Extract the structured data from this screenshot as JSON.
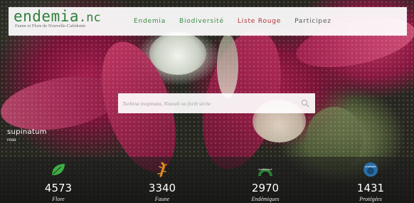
{
  "header": {
    "logo": {
      "main": "endemia",
      "suffix": ".nc",
      "subtitle": "Faune et Flore de Nouvelle-Calédonie"
    },
    "nav": [
      {
        "label": "Endemia"
      },
      {
        "label": "Biodiversité"
      },
      {
        "label": "Liste Rouge"
      },
      {
        "label": "Participez"
      }
    ]
  },
  "search": {
    "placeholder": "Turbina inopinata, Niaouli ou forêt sèche",
    "icon": "search-icon"
  },
  "photo_caption": {
    "name": "supinatum",
    "author": "reau"
  },
  "stats": [
    {
      "value": "4573",
      "label": "Flore",
      "icon": "leaf-icon",
      "color": "#3cb043"
    },
    {
      "value": "3340",
      "label": "Faune",
      "icon": "gecko-icon",
      "color": "#e08a1e"
    },
    {
      "value": "2970",
      "label": "Endémiques",
      "icon": "endemic-badge-icon",
      "icon_text": "endémique",
      "color": "#2e7d32"
    },
    {
      "value": "1431",
      "label": "Protégées",
      "icon": "protected-badge-icon",
      "icon_text": "protégée",
      "color": "#2a6fa8"
    }
  ]
}
